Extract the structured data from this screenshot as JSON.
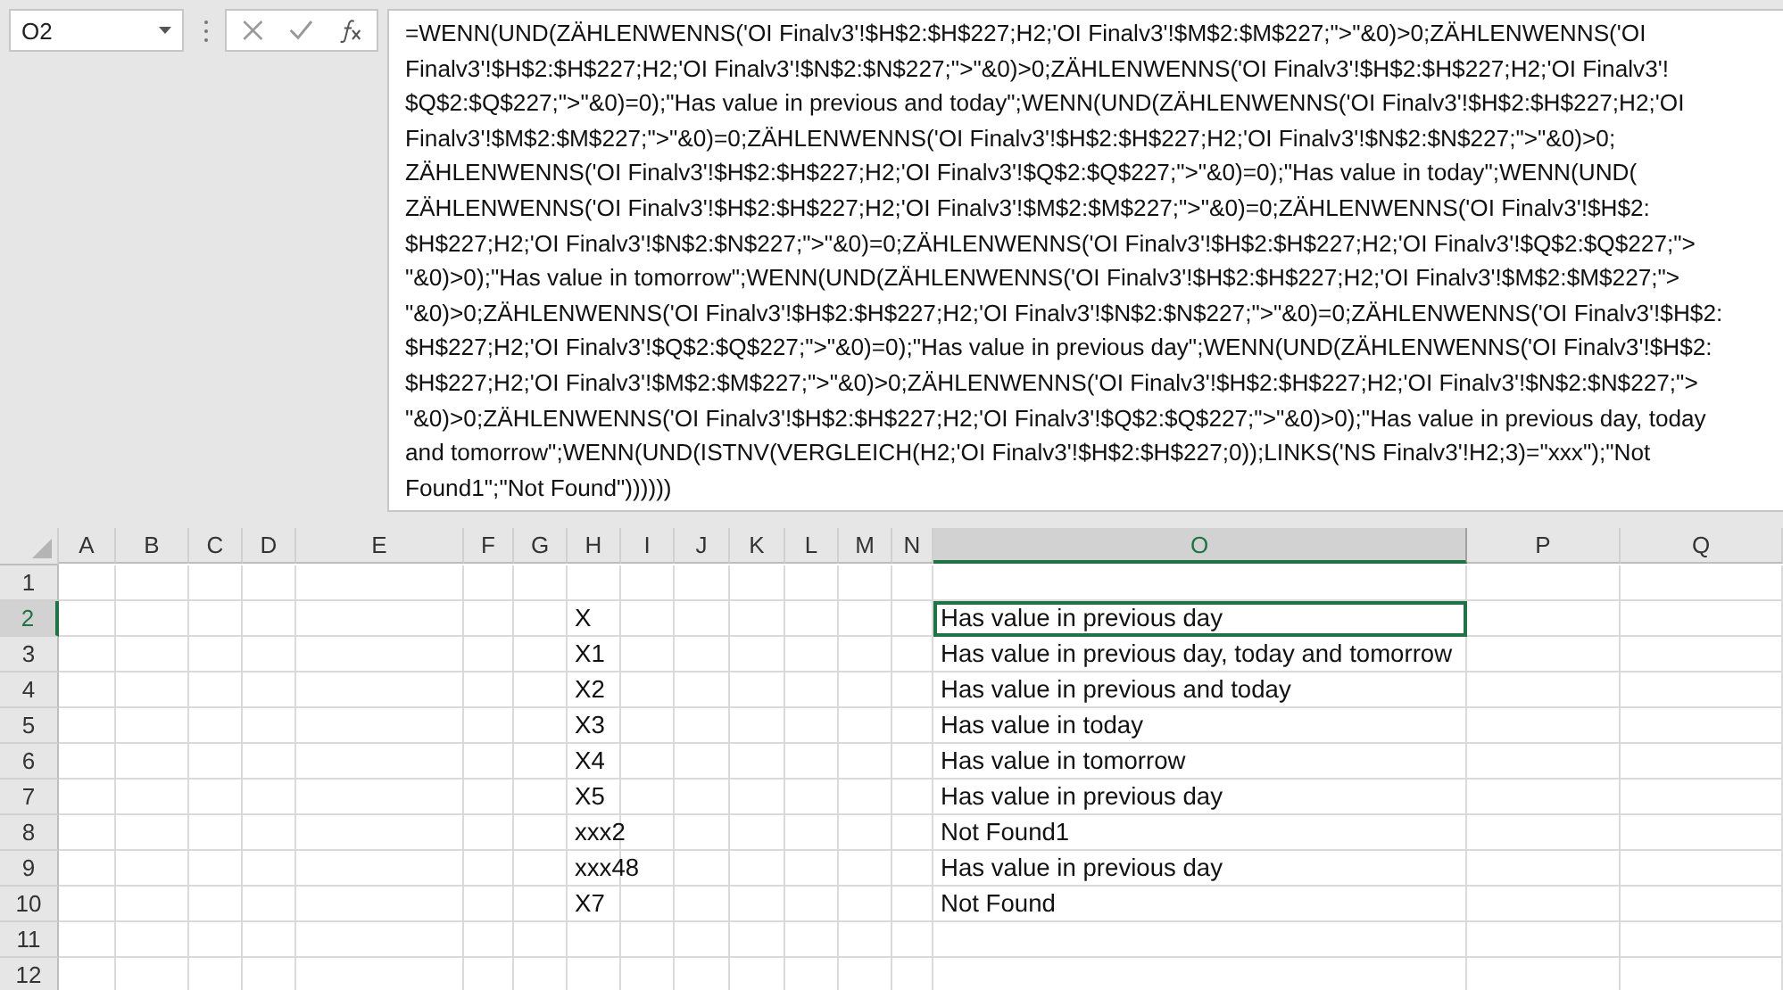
{
  "name_box": {
    "value": "O2"
  },
  "formula_bar": {
    "lines": [
      "=WENN(UND(ZÄHLENWENNS('OI Finalv3'!$H$2:$H$227;H2;'OI Finalv3'!$M$2:$M$227;\">\"&0)>0;ZÄHLENWENNS('OI",
      "Finalv3'!$H$2:$H$227;H2;'OI Finalv3'!$N$2:$N$227;\">\"&0)>0;ZÄHLENWENNS('OI Finalv3'!$H$2:$H$227;H2;'OI Finalv3'!",
      "$Q$2:$Q$227;\">\"&0)=0);\"Has value in previous and today\";WENN(UND(ZÄHLENWENNS('OI Finalv3'!$H$2:$H$227;H2;'OI",
      "Finalv3'!$M$2:$M$227;\">\"&0)=0;ZÄHLENWENNS('OI Finalv3'!$H$2:$H$227;H2;'OI Finalv3'!$N$2:$N$227;\">\"&0)>0;",
      "ZÄHLENWENNS('OI Finalv3'!$H$2:$H$227;H2;'OI Finalv3'!$Q$2:$Q$227;\">\"&0)=0);\"Has value in today\";WENN(UND(",
      "ZÄHLENWENNS('OI Finalv3'!$H$2:$H$227;H2;'OI Finalv3'!$M$2:$M$227;\">\"&0)=0;ZÄHLENWENNS('OI Finalv3'!$H$2:",
      "$H$227;H2;'OI Finalv3'!$N$2:$N$227;\">\"&0)=0;ZÄHLENWENNS('OI Finalv3'!$H$2:$H$227;H2;'OI Finalv3'!$Q$2:$Q$227;\">",
      "\"&0)>0);\"Has value in tomorrow\";WENN(UND(ZÄHLENWENNS('OI Finalv3'!$H$2:$H$227;H2;'OI Finalv3'!$M$2:$M$227;\">",
      "\"&0)>0;ZÄHLENWENNS('OI Finalv3'!$H$2:$H$227;H2;'OI Finalv3'!$N$2:$N$227;\">\"&0)=0;ZÄHLENWENNS('OI Finalv3'!$H$2:",
      "$H$227;H2;'OI Finalv3'!$Q$2:$Q$227;\">\"&0)=0);\"Has value in previous day\";WENN(UND(ZÄHLENWENNS('OI Finalv3'!$H$2:",
      "$H$227;H2;'OI Finalv3'!$M$2:$M$227;\">\"&0)>0;ZÄHLENWENNS('OI Finalv3'!$H$2:$H$227;H2;'OI Finalv3'!$N$2:$N$227;\">",
      "\"&0)>0;ZÄHLENWENNS('OI Finalv3'!$H$2:$H$227;H2;'OI Finalv3'!$Q$2:$Q$227;\">\"&0)>0);\"Has value in previous day, today",
      "and tomorrow\";WENN(UND(ISTNV(VERGLEICH(H2;'OI Finalv3'!$H$2:$H$227;0));LINKS('NS Finalv3'!H2;3)=\"xxx\");\"Not",
      "Found1\";\"Not Found\"))))))"
    ]
  },
  "columns": [
    {
      "label": "A",
      "selected": false
    },
    {
      "label": "B",
      "selected": false
    },
    {
      "label": "C",
      "selected": false
    },
    {
      "label": "D",
      "selected": false
    },
    {
      "label": "E",
      "selected": false
    },
    {
      "label": "F",
      "selected": false
    },
    {
      "label": "G",
      "selected": false
    },
    {
      "label": "H",
      "selected": false
    },
    {
      "label": "I",
      "selected": false
    },
    {
      "label": "J",
      "selected": false
    },
    {
      "label": "K",
      "selected": false
    },
    {
      "label": "L",
      "selected": false
    },
    {
      "label": "M",
      "selected": false
    },
    {
      "label": "N",
      "selected": false
    },
    {
      "label": "O",
      "selected": true
    },
    {
      "label": "P",
      "selected": false
    },
    {
      "label": "Q",
      "selected": false
    }
  ],
  "rows": [
    {
      "number": "1",
      "selected": false
    },
    {
      "number": "2",
      "selected": true,
      "h": "X",
      "o": "Has value in previous day"
    },
    {
      "number": "3",
      "selected": false,
      "h": "X1",
      "o": "Has value in previous day, today and tomorrow"
    },
    {
      "number": "4",
      "selected": false,
      "h": "X2",
      "o": "Has value in previous and today"
    },
    {
      "number": "5",
      "selected": false,
      "h": "X3",
      "o": "Has value in today"
    },
    {
      "number": "6",
      "selected": false,
      "h": "X4",
      "o": "Has value in tomorrow"
    },
    {
      "number": "7",
      "selected": false,
      "h": "X5",
      "o": "Has value in previous day"
    },
    {
      "number": "8",
      "selected": false,
      "h": "xxx2",
      "o": "Not Found1"
    },
    {
      "number": "9",
      "selected": false,
      "h": "xxx48",
      "o": "Has value in previous day"
    },
    {
      "number": "10",
      "selected": false,
      "h": "X7",
      "o": "Not Found"
    },
    {
      "number": "11",
      "selected": false
    },
    {
      "number": "12",
      "selected": false
    }
  ]
}
